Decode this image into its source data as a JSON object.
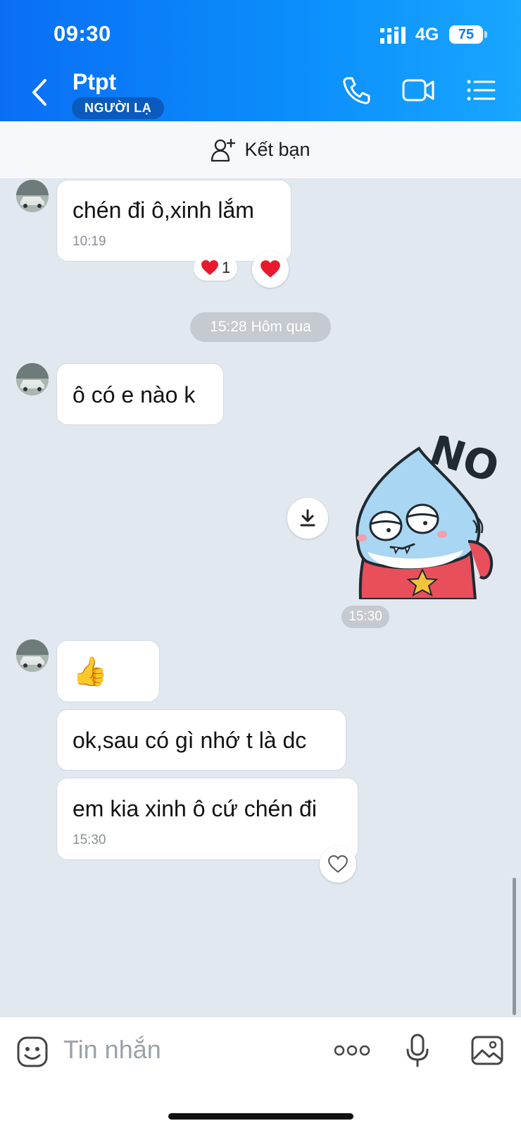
{
  "status_bar": {
    "time": "09:30",
    "network": "4G",
    "battery": "75"
  },
  "header": {
    "name": "Ptpt",
    "badge": "NGƯỜI LẠ"
  },
  "friend_bar": {
    "label": "Kết bạn"
  },
  "messages": {
    "m1": {
      "text": "chén đi ô,xinh lắm",
      "time": "10:19",
      "reaction_count": "1"
    },
    "divider": "15:28 Hôm qua",
    "m2": {
      "text": "ô có e nào k"
    },
    "sticker": {
      "text": "NO",
      "time": "15:30"
    },
    "m3": {
      "emoji": "👍"
    },
    "m4": {
      "text": "ok,sau có gì nhớ t là dc"
    },
    "m5": {
      "text": "em kia xinh ô cứ chén đi",
      "time": "15:30"
    }
  },
  "composer": {
    "placeholder": "Tin nhắn"
  },
  "colors": {
    "header_start": "#0a6ef5",
    "header_end": "#18a6ff",
    "badge": "#0a5bbd",
    "chat_bg": "#e2e8f0",
    "heart": "#e8192c"
  },
  "icons": [
    "back-icon",
    "phone-icon",
    "video-call-icon",
    "menu-icon",
    "add-friend-icon",
    "heart-icon",
    "download-icon",
    "emoji-icon",
    "more-icon",
    "microphone-icon",
    "image-icon"
  ]
}
